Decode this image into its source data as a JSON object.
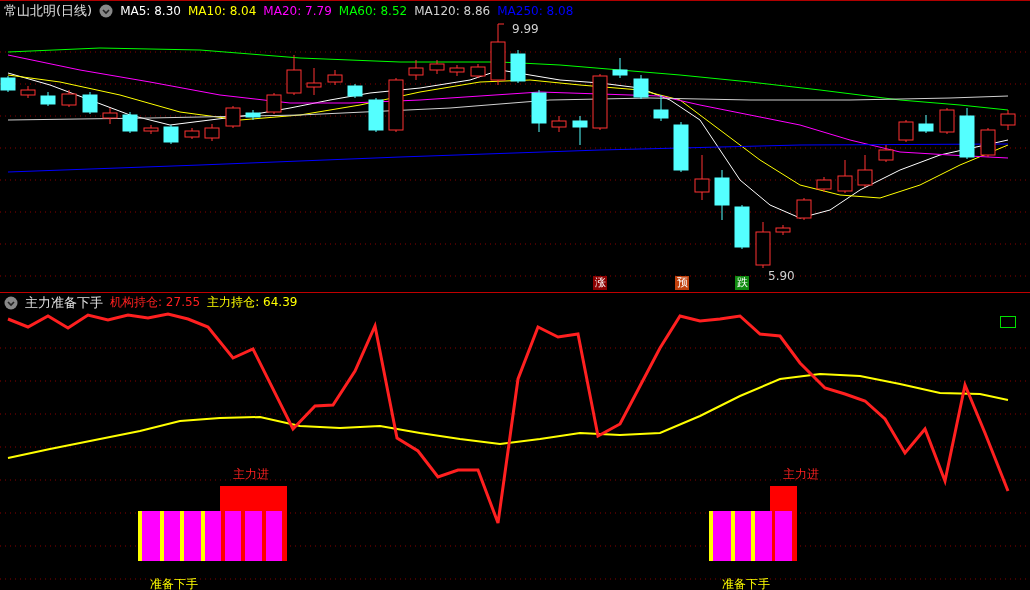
{
  "title": {
    "name": "常山北明(日线)"
  },
  "ma": [
    {
      "label": "MA5: 8.30",
      "color": "#ffffff"
    },
    {
      "label": "MA10: 8.04",
      "color": "#ffff00"
    },
    {
      "label": "MA20: 7.79",
      "color": "#ff00ff"
    },
    {
      "label": "MA60: 8.52",
      "color": "#00ff00"
    },
    {
      "label": "MA120: 8.86",
      "color": "#d0d0d0"
    },
    {
      "label": "MA250: 8.08",
      "color": "#0000ff"
    }
  ],
  "price_marks": [
    {
      "kind": "high",
      "text": "9.99"
    },
    {
      "kind": "low",
      "text": "5.90"
    }
  ],
  "signals": [
    {
      "text": "涨",
      "color": "#8b0000"
    },
    {
      "text": "预",
      "color": "#c0400c"
    },
    {
      "text": "跌",
      "color": "#108a10"
    }
  ],
  "indicator": {
    "name": "主力准备下手",
    "readouts": [
      {
        "label": "机构持仓: 27.55",
        "color": "#ff2020"
      },
      {
        "label": "主力持仓: 64.39",
        "color": "#ffff00"
      }
    ],
    "markers": [
      {
        "kind": "enter",
        "text": "主力进"
      },
      {
        "kind": "ready",
        "text": "准备下手"
      },
      {
        "kind": "enter",
        "text": "主力进"
      },
      {
        "kind": "ready",
        "text": "准备下手"
      }
    ]
  }
}
